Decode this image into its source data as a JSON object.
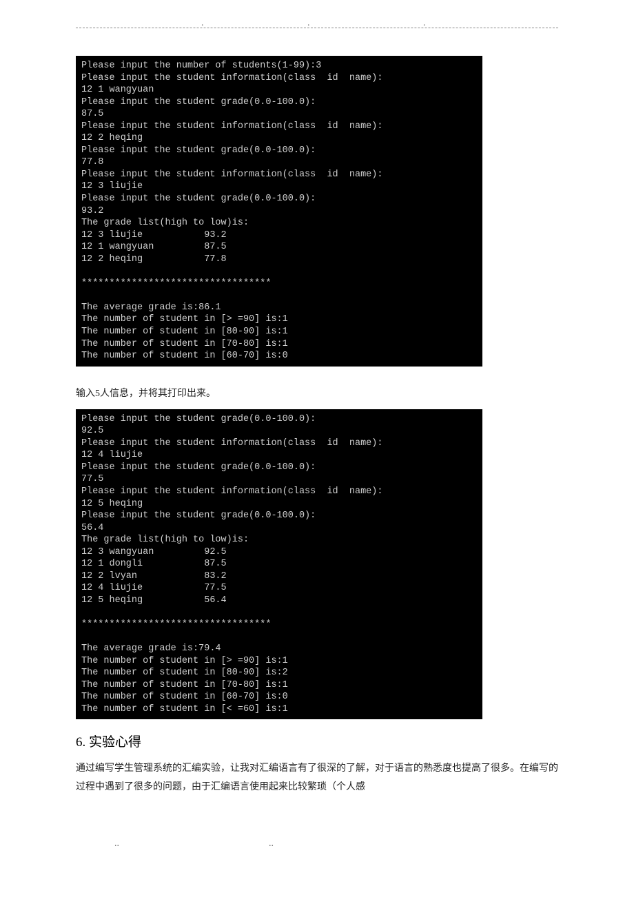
{
  "terminal1": {
    "lines": [
      "Please input the number of students(1-99):3",
      "Please input the student information(class  id  name):",
      "12 1 wangyuan",
      "Please input the student grade(0.0-100.0):",
      "87.5",
      "Please input the student information(class  id  name):",
      "12 2 heqing",
      "Please input the student grade(0.0-100.0):",
      "77.8",
      "Please input the student information(class  id  name):",
      "12 3 liujie",
      "Please input the student grade(0.0-100.0):",
      "93.2",
      "The grade list(high to low)is:",
      "12 3 liujie           93.2",
      "12 1 wangyuan         87.5",
      "12 2 heqing           77.8",
      "",
      "**********************************",
      "",
      "The average grade is:86.1",
      "The number of student in [> =90] is:1",
      "The number of student in [80-90] is:1",
      "The number of student in [70-80] is:1",
      "The number of student in [60-70] is:0"
    ]
  },
  "caption": "输入5人信息，并将其打印出来。",
  "terminal2": {
    "lines": [
      "Please input the student grade(0.0-100.0):",
      "92.5",
      "Please input the student information(class  id  name):",
      "12 4 liujie",
      "Please input the student grade(0.0-100.0):",
      "77.5",
      "Please input the student information(class  id  name):",
      "12 5 heqing",
      "Please input the student grade(0.0-100.0):",
      "56.4",
      "The grade list(high to low)is:",
      "12 3 wangyuan         92.5",
      "12 1 dongli           87.5",
      "12 2 lvyan            83.2",
      "12 4 liujie           77.5",
      "12 5 heqing           56.4",
      "",
      "**********************************",
      "",
      "The average grade is:79.4",
      "The number of student in [> =90] is:1",
      "The number of student in [80-90] is:2",
      "The number of student in [70-80] is:1",
      "The number of student in [60-70] is:0",
      "The number of student in [< =60] is:1"
    ]
  },
  "section": {
    "num": "6.",
    "title": "实验心得"
  },
  "body": "通过编写学生管理系统的汇编实验，让我对汇编语言有了很深的了解，对于语言的熟悉度也提高了很多。在编写的过程中遇到了很多的问题，由于汇编语言使用起来比较繁琐（个人感"
}
